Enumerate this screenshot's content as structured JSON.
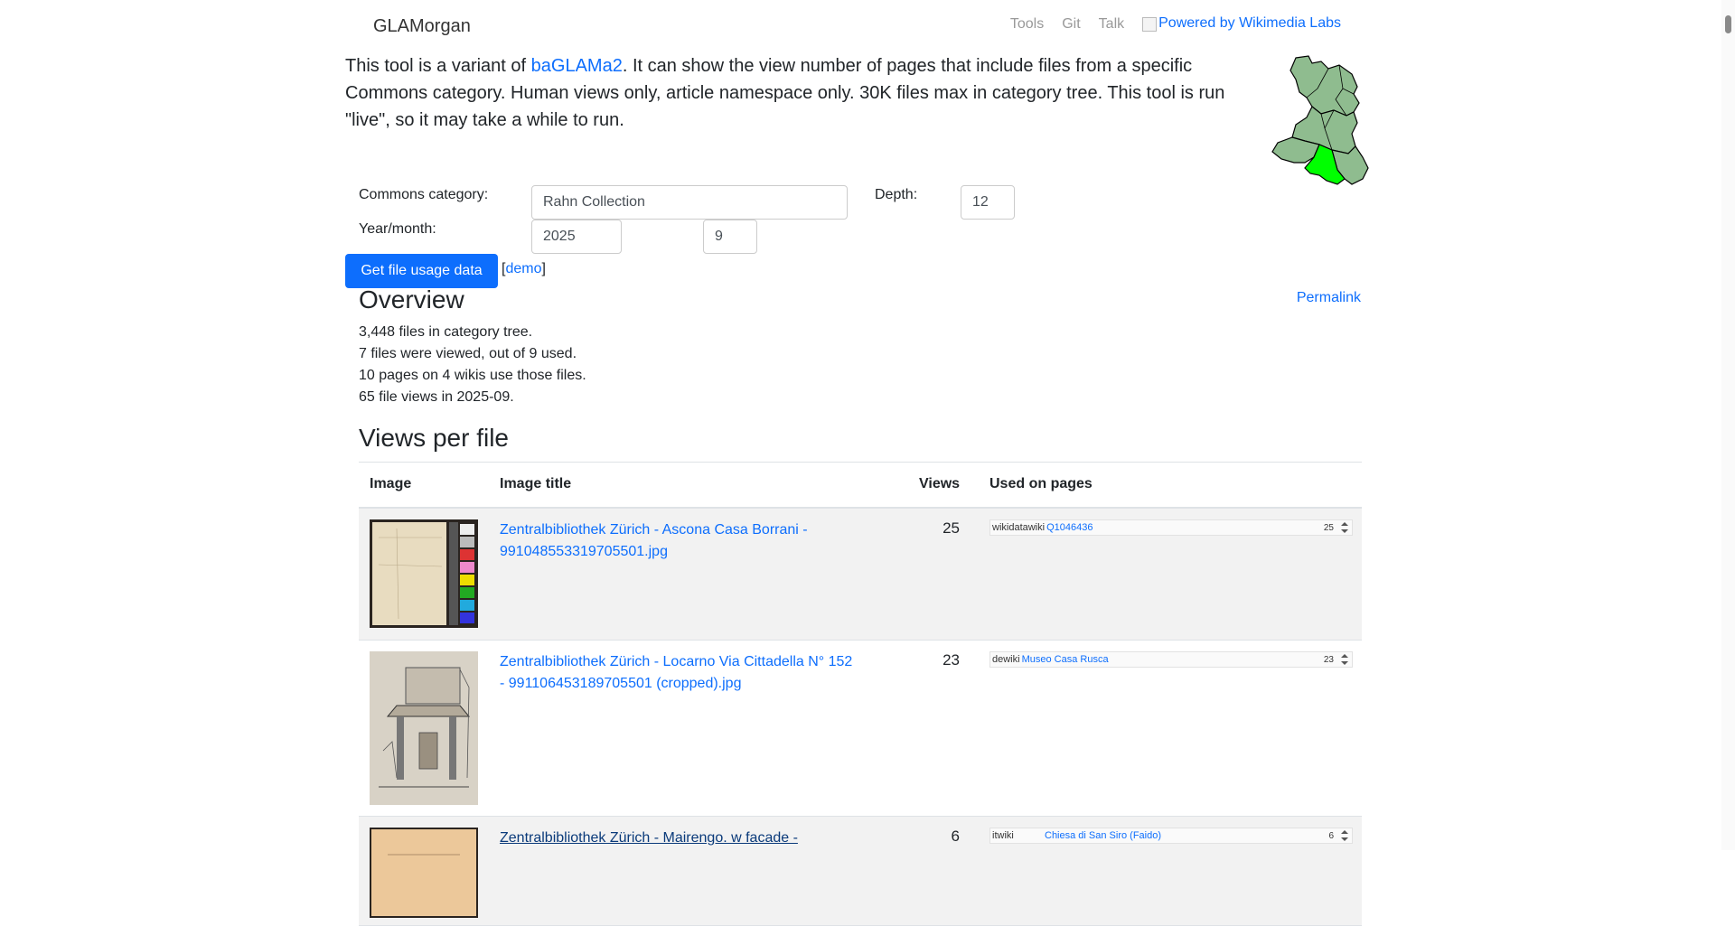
{
  "navbar": {
    "brand": "GLAMorgan",
    "links": [
      "Tools",
      "Git",
      "Talk"
    ],
    "wikimedia_alt": "Powered by Wikimedia Labs"
  },
  "intro": {
    "text_before": "This tool is a variant of ",
    "link": "baGLAMa2",
    "text_after": ". It can show the view number of pages that include files from a specific Commons category. Human views only, article namespace only. 30K files max in category tree. This tool is run \"live\", so it may take a while to run."
  },
  "form": {
    "category_label": "Commons category:",
    "category_value": "Rahn Collection",
    "depth_label": "Depth:",
    "depth_value": "12",
    "yearmonth_label": "Year/month:",
    "year_value": "2025",
    "month_value": "9",
    "submit_label": "Get file usage data",
    "demo_prefix": "[",
    "demo_label": "demo",
    "demo_suffix": "]"
  },
  "overview": {
    "title": "Overview",
    "permalink": "Permalink",
    "stats": [
      "3,448 files in category tree.",
      "7 files were viewed, out of 9 used.",
      "10 pages on 4 wikis use those files.",
      "65 file views in 2025-09."
    ]
  },
  "views_per_file": {
    "title": "Views per file",
    "headers": {
      "image": "Image",
      "title": "Image title",
      "views": "Views",
      "used": "Used on pages"
    },
    "rows": [
      {
        "title": "Zentralbibliothek Zürich - Ascona Casa Borrani - 991048553319705501.jpg",
        "views": "25",
        "usage": [
          {
            "wiki": "wikidatawiki",
            "page": "Q1046436",
            "count": "25"
          }
        ]
      },
      {
        "title": "Zentralbibliothek Zürich - Locarno Via Cittadella N° 152 - 991106453189705501 (cropped).jpg",
        "views": "23",
        "usage": [
          {
            "wiki": "dewiki",
            "page": "Museo Casa Rusca",
            "count": "23"
          }
        ]
      },
      {
        "title": "Zentralbibliothek Zürich - Mairengo. w facade -",
        "views": "6",
        "usage": [
          {
            "wiki": "itwiki",
            "page": "Chiesa di San Siro (Faido)",
            "count": "6"
          }
        ]
      }
    ]
  },
  "colors": {
    "link": "#0d6efd",
    "button": "#0d6efd",
    "map_region": "#8fbc8f",
    "map_highlight": "#00ff00"
  }
}
